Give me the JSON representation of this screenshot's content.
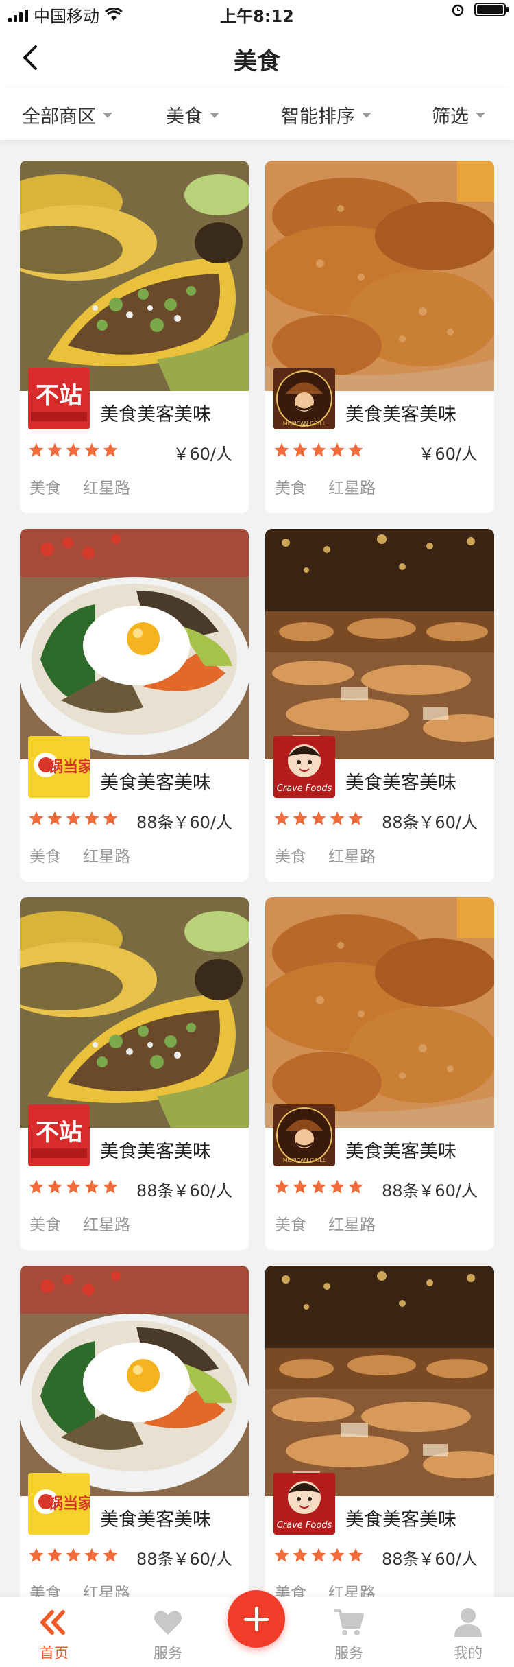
{
  "status_bar": {
    "carrier": "中国移动",
    "time": "上午8:12"
  },
  "header": {
    "title": "美食"
  },
  "filters": [
    {
      "label": "全部商区"
    },
    {
      "label": "美食"
    },
    {
      "label": "智能排序"
    },
    {
      "label": "筛选"
    }
  ],
  "cards": [
    {
      "name": "美食美客美味",
      "rating": 5,
      "count": "",
      "price": "￥60/人",
      "tags": [
        "美食",
        "红星路"
      ],
      "photo": "tacos",
      "logo": "不站"
    },
    {
      "name": "美食美客美味",
      "rating": 5,
      "count": "",
      "price": "￥60/人",
      "tags": [
        "美食",
        "红星路"
      ],
      "photo": "fried-chicken",
      "logo": "mexican-grill"
    },
    {
      "name": "美食美客美味",
      "rating": 5,
      "count": "88条",
      "price": "￥60/人",
      "tags": [
        "美食",
        "红星路"
      ],
      "photo": "bibimbap",
      "logo": "锅当家"
    },
    {
      "name": "美食美客美味",
      "rating": 5,
      "count": "88条",
      "price": "￥60/人",
      "tags": [
        "美食",
        "红星路"
      ],
      "photo": "bakery",
      "logo": "crave-foods"
    },
    {
      "name": "美食美客美味",
      "rating": 5,
      "count": "88条",
      "price": "￥60/人",
      "tags": [
        "美食",
        "红星路"
      ],
      "photo": "tacos",
      "logo": "不站"
    },
    {
      "name": "美食美客美味",
      "rating": 5,
      "count": "88条",
      "price": "￥60/人",
      "tags": [
        "美食",
        "红星路"
      ],
      "photo": "fried-chicken",
      "logo": "mexican-grill"
    },
    {
      "name": "美食美客美味",
      "rating": 5,
      "count": "88条",
      "price": "￥60/人",
      "tags": [
        "美食",
        "红星路"
      ],
      "photo": "bibimbap",
      "logo": "锅当家"
    },
    {
      "name": "美食美客美味",
      "rating": 5,
      "count": "88条",
      "price": "￥60/人",
      "tags": [
        "美食",
        "红星路"
      ],
      "photo": "bakery",
      "logo": "crave-foods"
    }
  ],
  "logo_text": {
    "bu_zhan": "不站",
    "guo_dang_jia": "锅当家",
    "crave": "Crave Foods",
    "mexican": "MEXICAN GRILL"
  },
  "tabbar": [
    {
      "label": "首页",
      "icon": "home-icon",
      "active": true
    },
    {
      "label": "服务",
      "icon": "heart-icon",
      "active": false
    },
    {
      "label": "",
      "icon": "plus-icon",
      "active": false
    },
    {
      "label": "服务",
      "icon": "cart-icon",
      "active": false
    },
    {
      "label": "我的",
      "icon": "user-icon",
      "active": false
    }
  ],
  "colors": {
    "accent": "#f05a28",
    "star": "#f26b3a",
    "plus": "#f13c2a"
  }
}
